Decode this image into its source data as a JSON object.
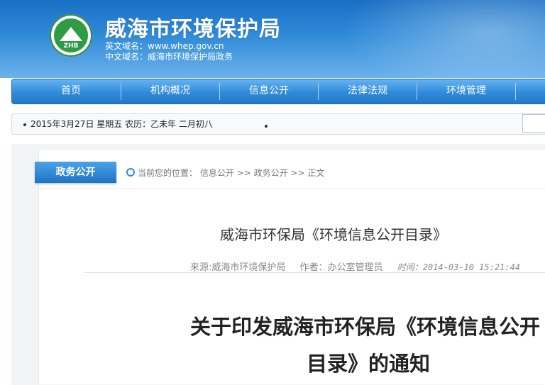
{
  "header": {
    "logo_text": "ZHB",
    "site_title": "威海市环境保护局",
    "english_domain": "英文域名：www.whep.gov.cn",
    "chinese_domain": "中文域名：威海市环境保护局政务"
  },
  "nav": {
    "items": [
      "首页",
      "机构概况",
      "信息公开",
      "法律法规",
      "环境管理"
    ]
  },
  "datebar": {
    "date_text": "2015年3月27日  星期五  农历：乙未年  二月初八"
  },
  "section": {
    "tab_label": "政务公开",
    "breadcrumb_prefix": "当前您的位置：",
    "breadcrumb": [
      "信息公开",
      "政务公开",
      "正文"
    ],
    "separator": ">>"
  },
  "article": {
    "title": "威海市环保局《环境信息公开目录》",
    "source": "来源:威海市环境保护局",
    "author": "作者：办公室管理员",
    "time": "时间：2014-03-10 15:21:44",
    "headline_line1": "关于印发威海市环保局《环境信息公开",
    "headline_line2": "目录》的通知"
  },
  "colors": {
    "header_blue": "#2f8ad8",
    "nav_blue": "#2579c7",
    "logo_green": "#2f9b45"
  }
}
